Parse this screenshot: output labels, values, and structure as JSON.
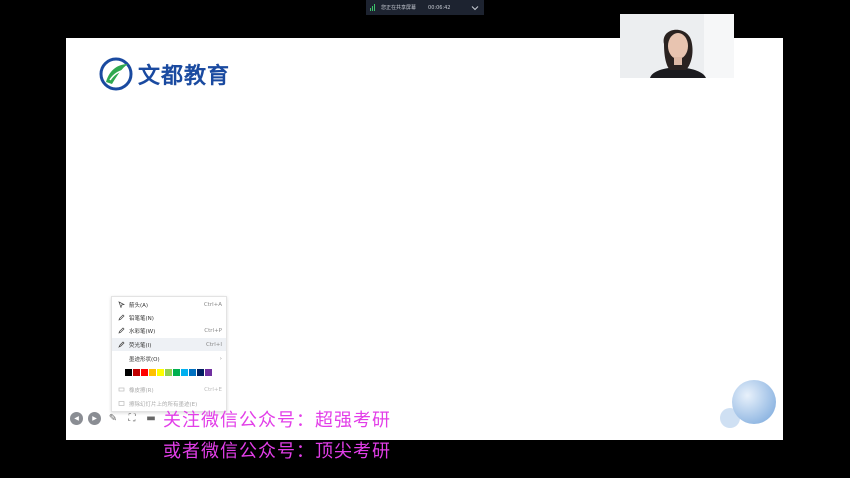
{
  "topbar": {
    "status_text": "您正在共享屏幕",
    "timer": "00:06:42"
  },
  "logo": {
    "text": "文都教育"
  },
  "context_menu": {
    "items": [
      {
        "label": "箭头(A)",
        "shortcut": "Ctrl+A",
        "icon": "arrow-cursor-icon"
      },
      {
        "label": "铅笔笔(N)",
        "shortcut": "",
        "icon": "pencil-icon"
      },
      {
        "label": "水彩笔(W)",
        "shortcut": "Ctrl+P",
        "icon": "pen-icon"
      },
      {
        "label": "荧光笔(I)",
        "shortcut": "Ctrl+I",
        "icon": "highlighter-icon",
        "highlighted": true
      },
      {
        "label": "墨迹形状(O)",
        "shortcut": "›",
        "icon": ""
      },
      {
        "label": "橡皮擦(R)",
        "shortcut": "Ctrl+E",
        "icon": "eraser-icon",
        "disabled": true
      },
      {
        "label": "擦除幻灯片上的所有墨迹(E)",
        "shortcut": "",
        "icon": "clear-ink-icon",
        "disabled": true
      }
    ],
    "colors": [
      "#000000",
      "#c00000",
      "#ff0000",
      "#ffc000",
      "#ffff00",
      "#92d050",
      "#00b050",
      "#00b0f0",
      "#0070c0",
      "#002060",
      "#7030a0"
    ]
  },
  "watermark": {
    "line1": "关注微信公众号：超强考研",
    "line2": "或者微信公众号：顶尖考研"
  },
  "colors": {
    "watermark": "#e23ee8",
    "logo_blue": "#1a4aa0",
    "logo_green": "#2fa84f"
  }
}
